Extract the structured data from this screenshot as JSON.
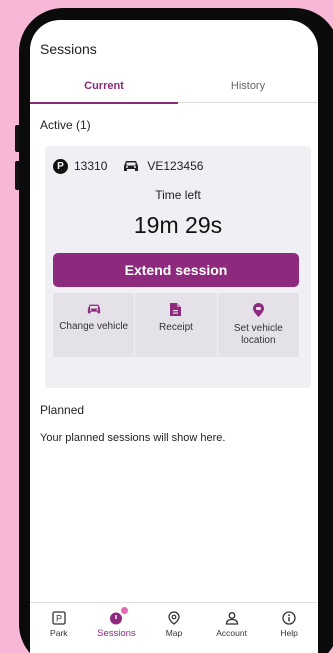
{
  "header": {
    "title": "Sessions"
  },
  "tabs": [
    {
      "label": "Current",
      "selected": true
    },
    {
      "label": "History",
      "selected": false
    }
  ],
  "active": {
    "title": "Active (1)",
    "zone_icon": "P",
    "zone": "13310",
    "plate": "VE123456",
    "time_label": "Time left",
    "time_value": "19m 29s",
    "extend_label": "Extend session",
    "actions": [
      {
        "icon": "car-icon",
        "label": "Change vehicle"
      },
      {
        "icon": "receipt-icon",
        "label": "Receipt"
      },
      {
        "icon": "location-pin-icon",
        "label": "Set vehicle location"
      }
    ]
  },
  "planned": {
    "title": "Planned",
    "message": "Your planned sessions will show here."
  },
  "nav": {
    "park_icon_glyph": "P",
    "items": [
      {
        "icon": "park-icon",
        "label": "Park"
      },
      {
        "icon": "sessions-icon",
        "label": "Sessions",
        "active": true
      },
      {
        "icon": "map-icon",
        "label": "Map"
      },
      {
        "icon": "account-icon",
        "label": "Account"
      },
      {
        "icon": "help-icon",
        "label": "Help"
      }
    ]
  },
  "colors": {
    "accent": "#8e2a7d",
    "background": "#f6b8d6",
    "card": "#f0eff3"
  }
}
